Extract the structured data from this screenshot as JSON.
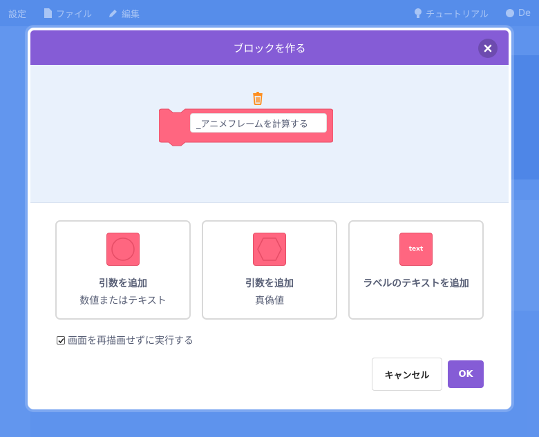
{
  "background": {
    "menu": {
      "settings_label": "設定",
      "file_label": "ファイル",
      "edit_label": "編集",
      "tutorials_label": "チュートリアル",
      "right_label": "De"
    }
  },
  "dialog": {
    "title": "ブロックを作る",
    "block_name": "_アニメフレームを計算する",
    "options": [
      {
        "title": "引数を追加",
        "subtitle": "数値またはテキスト",
        "icon": "round-input-icon"
      },
      {
        "title": "引数を追加",
        "subtitle": "真偽値",
        "icon": "boolean-input-icon"
      },
      {
        "title": "ラベルのテキストを追加",
        "subtitle": "",
        "icon_text": "text"
      }
    ],
    "run_without_refresh": {
      "label": "画面を再描画せずに実行する",
      "checked": true
    },
    "cancel_label": "キャンセル",
    "ok_label": "OK"
  },
  "colors": {
    "header_purple": "#855cd6",
    "block_pink": "#ff6680",
    "trash_orange": "#ff8c1a",
    "preview_bg": "#e9f1fc"
  }
}
